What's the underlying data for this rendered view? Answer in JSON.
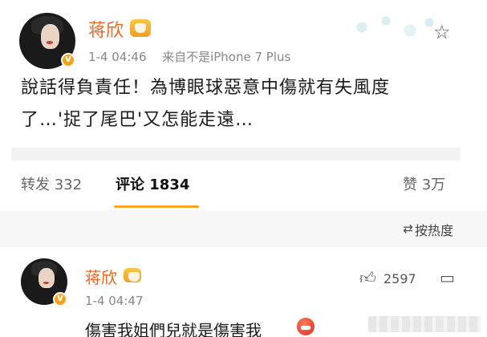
{
  "post": {
    "author": "蒋欣",
    "time": "1-4 04:46",
    "source": "来自不是iPhone 7 Plus",
    "content_line1": "說話得負責任！為博眼球惡意中傷就有失風度",
    "content_line2": "了…'捉了尾巴'又怎能走遠…"
  },
  "tabs": {
    "repost_label": "转发 332",
    "comment_label": "评论 1834",
    "like_label": "赞 3万"
  },
  "sort": {
    "label": "按热度",
    "icon": "sort-icon"
  },
  "comment": {
    "author": "蒋欣",
    "time": "1-4 04:47",
    "likes": "2597",
    "text": "傷害我姐們兒就是傷害我"
  },
  "colors": {
    "name": "#e86722",
    "accent": "#f5a623"
  }
}
